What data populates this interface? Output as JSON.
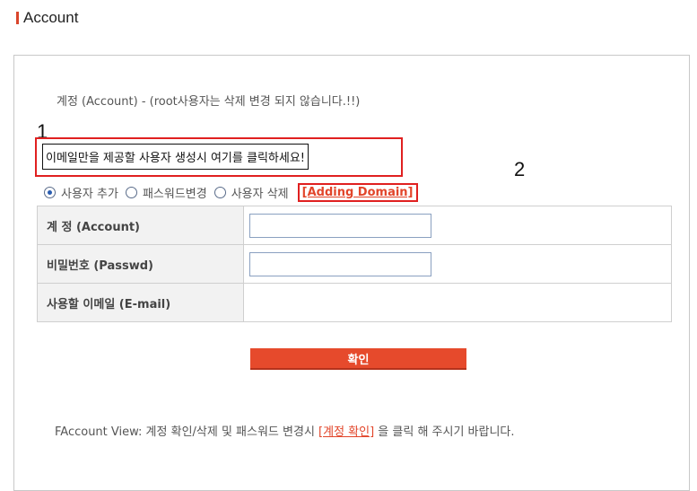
{
  "title": "Account",
  "notice": "계정 (Account) - (root사용자는 삭제 변경 되지 않습니다.!!)",
  "markers": [
    "1",
    "2"
  ],
  "email_only_link": "이메일만을 제공할 사용자 생성시 여기를 클릭하세요!",
  "radios": [
    {
      "label": "사용자 추가",
      "checked": true
    },
    {
      "label": "패스워드변경",
      "checked": false
    },
    {
      "label": "사용자 삭제",
      "checked": false
    }
  ],
  "adding_domain_link": "[Adding Domain]",
  "form": {
    "rows": [
      {
        "label": "계 정 (Account)",
        "value": ""
      },
      {
        "label": "비밀번호 (Passwd)",
        "value": ""
      },
      {
        "label": "사용할 이메일 (E-mail)",
        "value": ""
      }
    ]
  },
  "confirm_button": "확인",
  "footer": {
    "prefix": "FAccount View: 계정 확인/삭제 및 패스워드 변경시 ",
    "link": "[계정 확인]",
    "suffix": " 을 클릭 해 주시기 바랍니다."
  },
  "colors": {
    "accent": "#e64a2c",
    "highlight_border": "#e02020"
  }
}
